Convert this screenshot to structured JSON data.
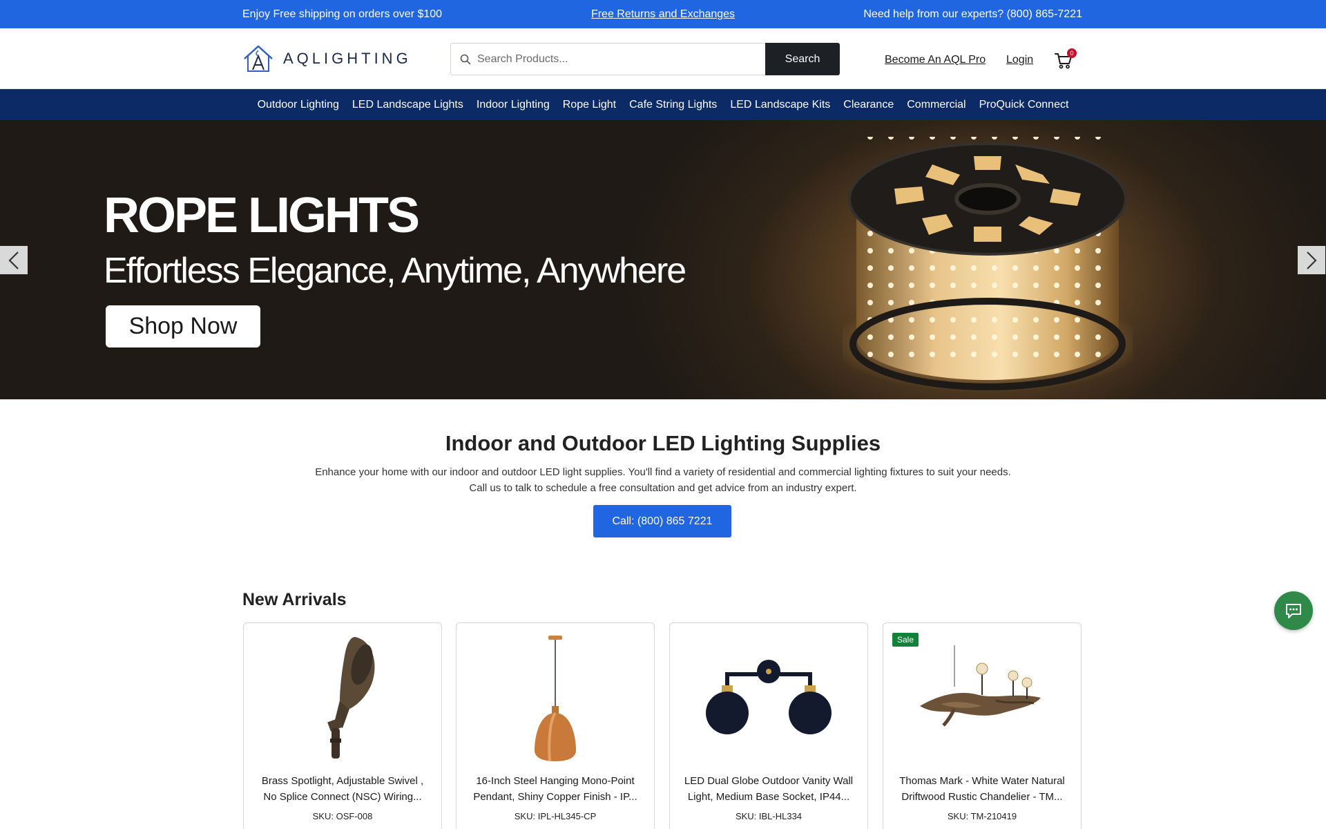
{
  "topbar": {
    "left": "Enjoy Free shipping on orders over $100",
    "middle": "Free Returns and Exchanges",
    "right": "Need help from our experts? (800) 865-7221"
  },
  "header": {
    "logo_text": "AQLIGHTING",
    "search_placeholder": "Search Products...",
    "search_button": "Search",
    "pro_link": "Become An AQL Pro",
    "login_link": "Login",
    "cart_count": "0"
  },
  "nav": {
    "items": [
      "Outdoor Lighting",
      "LED Landscape Lights",
      "Indoor Lighting",
      "Rope Light",
      "Cafe String Lights",
      "LED Landscape Kits",
      "Clearance",
      "Commercial",
      "ProQuick Connect"
    ]
  },
  "hero": {
    "title": "ROPE LIGHTS",
    "subtitle": "Effortless Elegance, Anytime, Anywhere",
    "button": "Shop Now"
  },
  "intro": {
    "title": "Indoor and Outdoor LED Lighting Supplies",
    "line1": "Enhance your home with our indoor and outdoor LED light supplies. You'll find a variety of residential and commercial lighting fixtures to suit your needs.",
    "line2": "Call us to talk to schedule a free consultation and get advice from an industry expert.",
    "call_button": "Call: (800) 865 7221"
  },
  "new_arrivals": {
    "title": "New Arrivals",
    "products": [
      {
        "name_1": "Brass Spotlight, Adjustable Swivel ,",
        "name_2": "No Splice Connect (NSC) Wiring...",
        "sku": "SKU: OSF-008",
        "badge": ""
      },
      {
        "name_1": "16-Inch Steel Hanging Mono-Point",
        "name_2": "Pendant, Shiny Copper Finish - IP...",
        "sku": "SKU: IPL-HL345-CP",
        "badge": ""
      },
      {
        "name_1": "LED Dual Globe Outdoor Vanity Wall",
        "name_2": "Light, Medium Base Socket, IP44...",
        "sku": "SKU: IBL-HL334",
        "badge": ""
      },
      {
        "name_1": "Thomas Mark - White Water Natural",
        "name_2": "Driftwood Rustic Chandelier - TM...",
        "sku": "SKU: TM-210419",
        "badge": "Sale"
      }
    ]
  },
  "colors": {
    "topbar": "#1f66e0",
    "nav": "#0b2a66",
    "primary_button": "#1f66e0",
    "sale_badge": "#12823b",
    "chat_button": "#2f8a4a"
  },
  "icons": {
    "search": "search-icon",
    "cart": "cart-icon",
    "chat": "chat-icon",
    "prev": "chevron-left-icon",
    "next": "chevron-right-icon"
  }
}
